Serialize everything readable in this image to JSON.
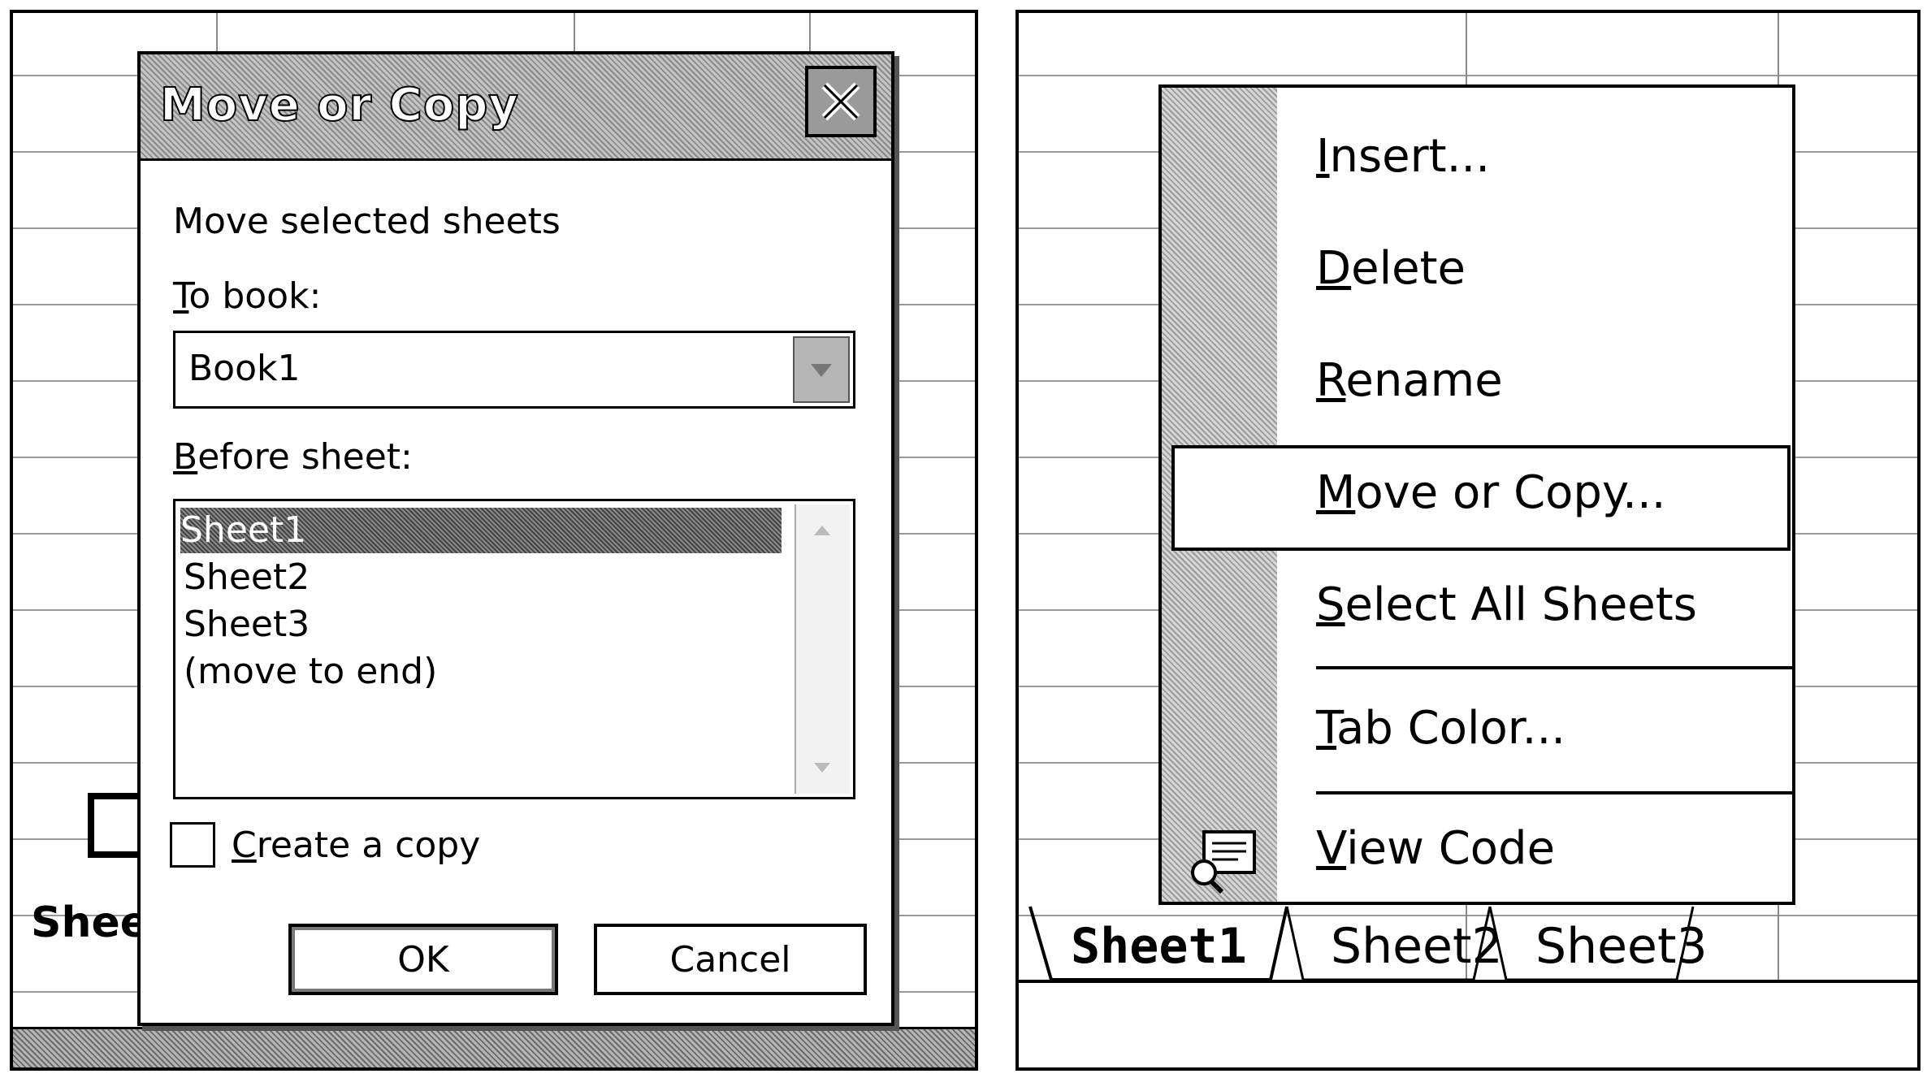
{
  "left_panel": {
    "dialog": {
      "title": "Move or Copy",
      "prompt": "Move selected sheets",
      "to_book_label_prefix": "T",
      "to_book_label_rest": "o book:",
      "to_book_value": "Book1",
      "before_sheet_label_prefix": "B",
      "before_sheet_label_rest": "efore sheet:",
      "sheets": [
        "Sheet1",
        "Sheet2",
        "Sheet3",
        "(move to end)"
      ],
      "create_copy_label_prefix": "C",
      "create_copy_label_rest": "reate a copy",
      "create_copy_checked": false,
      "ok_label": "OK",
      "cancel_label": "Cancel"
    },
    "sheet_tab_partial": "Shee"
  },
  "right_panel": {
    "menu": {
      "items": [
        {
          "prefix": "I",
          "rest": "nsert..."
        },
        {
          "prefix": "D",
          "rest": "elete"
        },
        {
          "prefix": "R",
          "rest": "ename"
        },
        {
          "prefix": "M",
          "rest": "ove or Copy..."
        },
        {
          "prefix": "S",
          "rest": "elect All Sheets"
        },
        {
          "prefix": "T",
          "rest": "ab Color..."
        },
        {
          "prefix": "V",
          "rest": "iew Code"
        }
      ],
      "highlighted": "Move or Copy..."
    },
    "tabs": [
      "Sheet1",
      "Sheet2",
      "Sheet3"
    ],
    "active_tab": "Sheet1"
  }
}
